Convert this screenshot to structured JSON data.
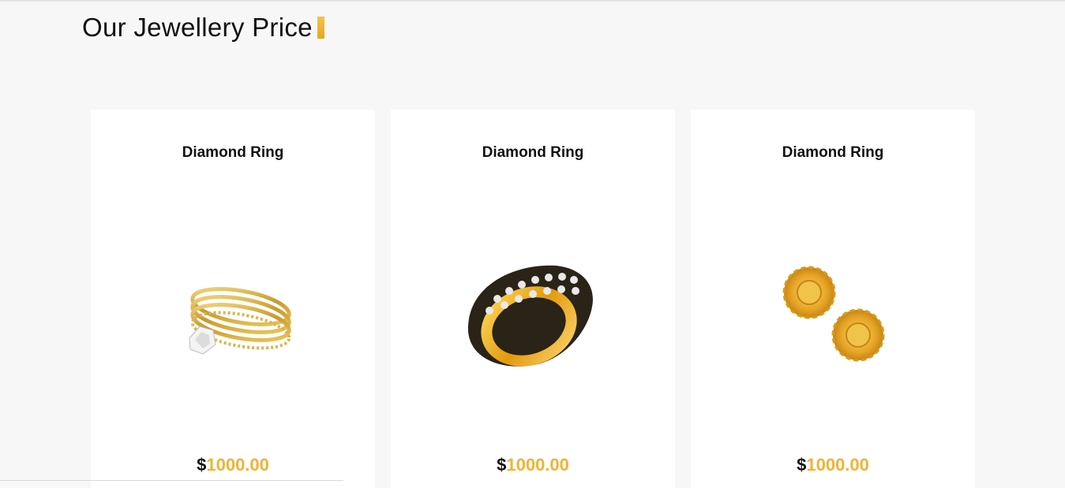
{
  "section": {
    "title": "Our Jewellery Price"
  },
  "products": [
    {
      "name": "Diamond Ring",
      "currency": "$",
      "price": "1000.00",
      "image": "gold-diamond-ring-image"
    },
    {
      "name": "Diamond Ring",
      "currency": "$",
      "price": "1000.00",
      "image": "gold-band-ring-image"
    },
    {
      "name": "Diamond Ring",
      "currency": "$",
      "price": "1000.00",
      "image": "gold-stud-earrings-image"
    }
  ],
  "colors": {
    "accent": "#f2b233",
    "background": "#f7f7f7",
    "card": "#ffffff"
  }
}
